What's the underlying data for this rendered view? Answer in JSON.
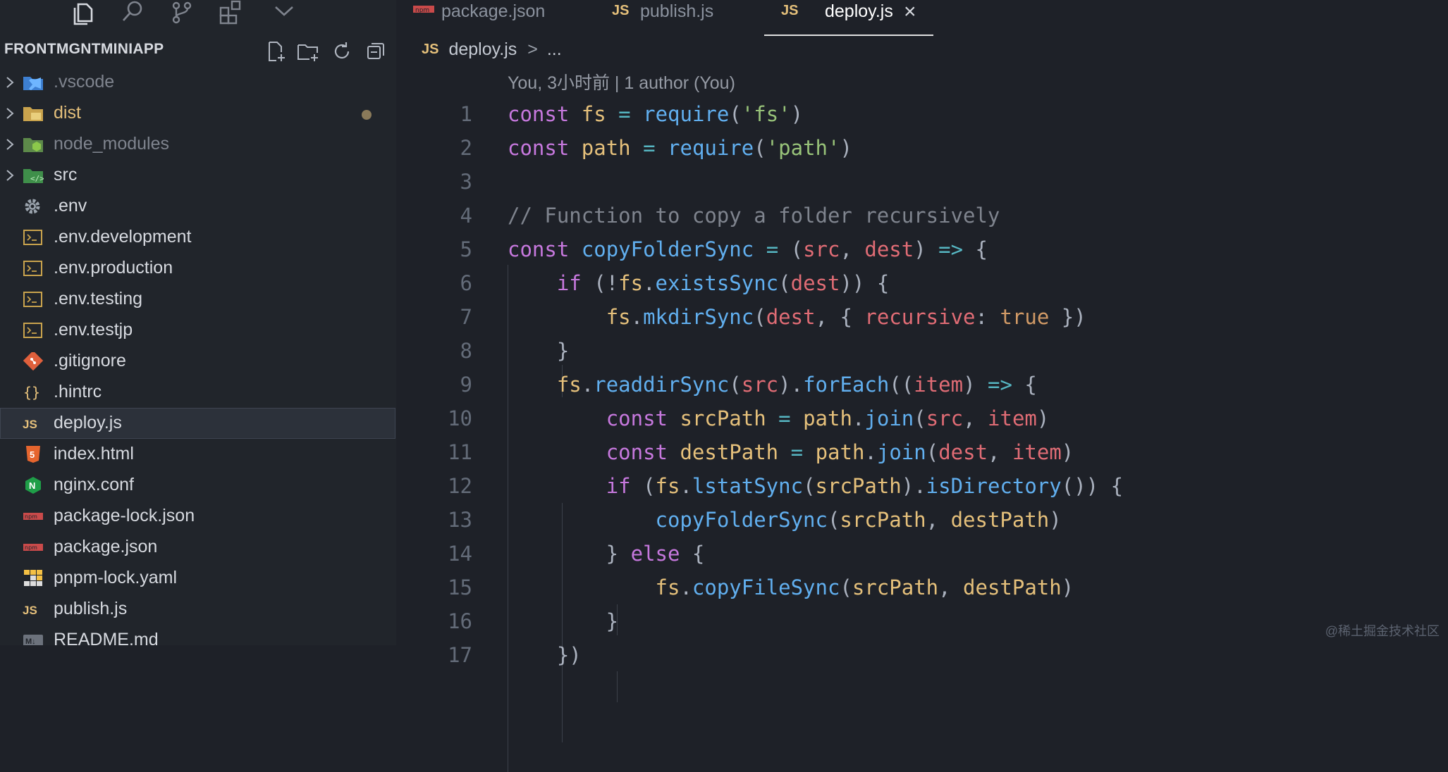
{
  "explorer": {
    "project_title": "FRONTMGNTMINIAPP",
    "files": [
      {
        "name": ".vscode",
        "icon": "vscode-folder-icon",
        "folder": true,
        "style": "dim"
      },
      {
        "name": "dist",
        "icon": "folder-icon",
        "folder": true,
        "style": "mod",
        "modified_dot": true
      },
      {
        "name": "node_modules",
        "icon": "node-folder-icon",
        "folder": true,
        "style": "dim"
      },
      {
        "name": "src",
        "icon": "src-folder-icon",
        "folder": true
      },
      {
        "name": ".env",
        "icon": "gear-icon"
      },
      {
        "name": ".env.development",
        "icon": "terminal-file-icon"
      },
      {
        "name": ".env.production",
        "icon": "terminal-file-icon"
      },
      {
        "name": ".env.testing",
        "icon": "terminal-file-icon"
      },
      {
        "name": ".env.testjp",
        "icon": "terminal-file-icon"
      },
      {
        "name": ".gitignore",
        "icon": "git-icon"
      },
      {
        "name": ".hintrc",
        "icon": "braces-icon"
      },
      {
        "name": "deploy.js",
        "icon": "js-icon",
        "selected": true
      },
      {
        "name": "index.html",
        "icon": "html5-icon"
      },
      {
        "name": "nginx.conf",
        "icon": "nginx-icon"
      },
      {
        "name": "package-lock.json",
        "icon": "npm-icon"
      },
      {
        "name": "package.json",
        "icon": "npm-icon"
      },
      {
        "name": "pnpm-lock.yaml",
        "icon": "pnpm-icon"
      },
      {
        "name": "publish.js",
        "icon": "js-icon"
      },
      {
        "name": "README.md",
        "icon": "markdown-icon"
      }
    ]
  },
  "tabs": [
    {
      "label": "package.json",
      "icon": "npm-icon"
    },
    {
      "label": "publish.js",
      "icon": "js-icon",
      "icon_text": "JS"
    },
    {
      "label": "deploy.js",
      "icon": "js-icon",
      "icon_text": "JS",
      "active": true,
      "close": "×"
    }
  ],
  "breadcrumb": {
    "icon_text": "JS",
    "file": "deploy.js",
    "sep": ">",
    "more": "..."
  },
  "codelens": "You, 3小时前 | 1 author (You)",
  "code": {
    "line_numbers": [
      "1",
      "2",
      "3",
      "4",
      "5",
      "6",
      "7",
      "8",
      "9",
      "10",
      "11",
      "12",
      "13",
      "14",
      "15",
      "16",
      "17"
    ],
    "lines": [
      "const fs = require('fs')",
      "const path = require('path')",
      "",
      "// Function to copy a folder recursively",
      "const copyFolderSync = (src, dest) => {",
      "    if (!fs.existsSync(dest)) {",
      "        fs.mkdirSync(dest, { recursive: true })",
      "    }",
      "    fs.readdirSync(src).forEach((item) => {",
      "        const srcPath = path.join(src, item)",
      "        const destPath = path.join(dest, item)",
      "        if (fs.lstatSync(srcPath).isDirectory()) {",
      "            copyFolderSync(srcPath, destPath)",
      "        } else {",
      "            fs.copyFileSync(srcPath, destPath)",
      "        }",
      "    })"
    ]
  },
  "watermark": "@稀土掘金技术社区",
  "colors": {
    "keyword": "#c678dd",
    "variable": "#e5c07b",
    "function": "#61afef",
    "string": "#98c379",
    "param": "#e06c75",
    "comment": "#7f848e"
  }
}
